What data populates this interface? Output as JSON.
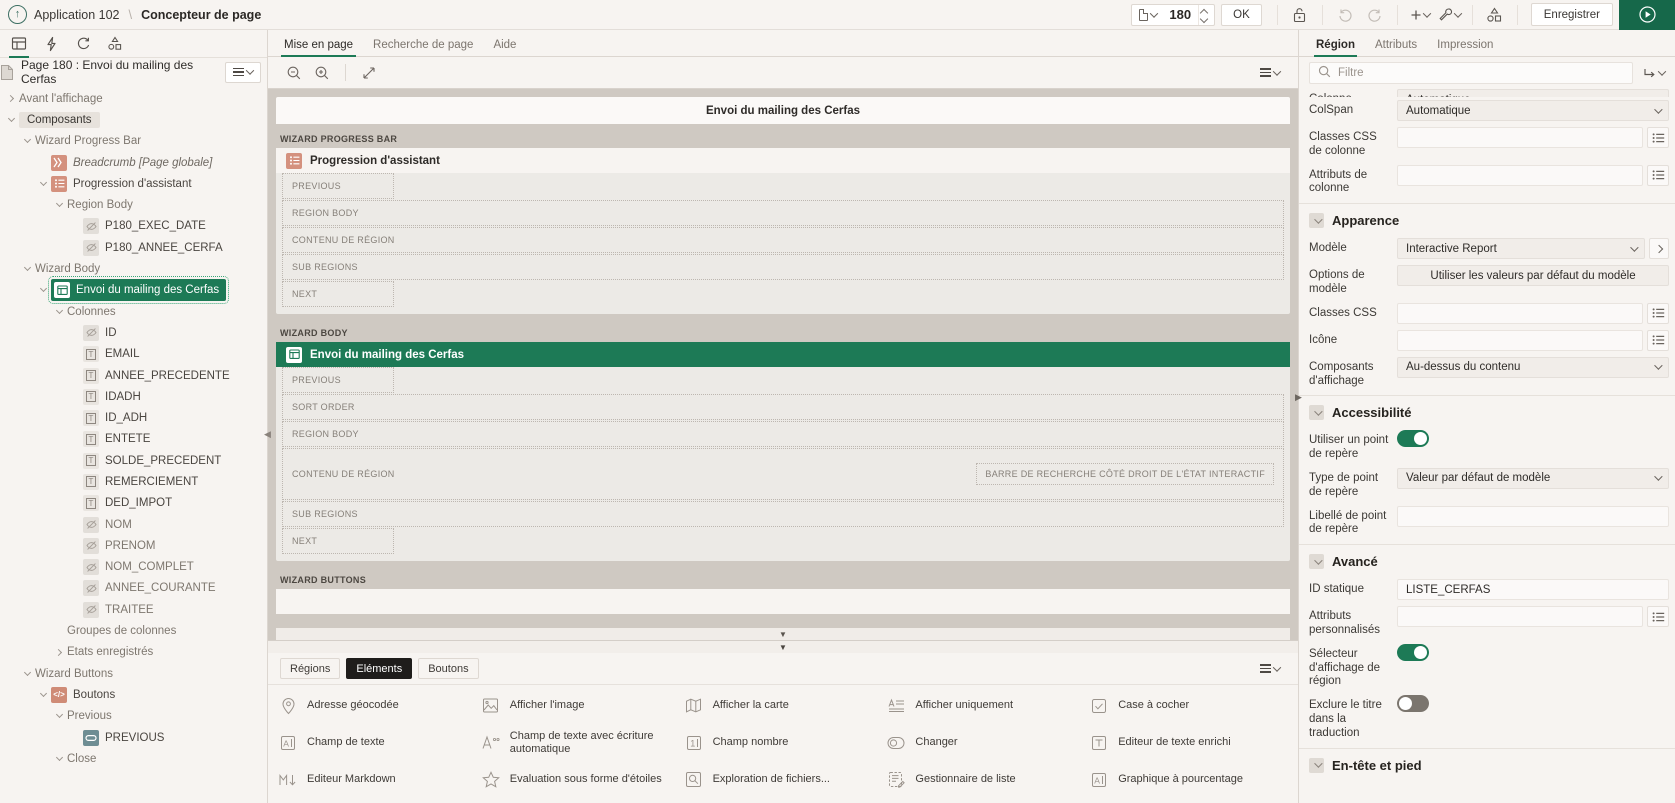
{
  "header": {
    "back_icon": "back-arrow-icon",
    "app_label": "Application 102",
    "separator": "\\",
    "page_designer_label": "Concepteur de page",
    "page_number": "180",
    "ok_label": "OK",
    "save_label": "Enregistrer",
    "icons": [
      "page-select-icon",
      "lock-icon",
      "undo-icon",
      "redo-icon",
      "add-icon",
      "utilities-icon",
      "shapes-icon",
      "run-icon"
    ]
  },
  "left_panel": {
    "tabs": [
      {
        "name": "page-layout-tab",
        "icon": "layout-icon",
        "selected": true
      },
      {
        "name": "dynamic-actions-tab",
        "icon": "lightning-icon",
        "selected": false
      },
      {
        "name": "processing-tab",
        "icon": "refresh-icon",
        "selected": false
      },
      {
        "name": "shared-components-tab",
        "icon": "shapes-icon",
        "selected": false
      }
    ],
    "page_title": "Page 180 : Envoi du mailing des Cerfas",
    "menu_label": "tree-menu-button",
    "tree": [
      {
        "label": "Avant l'affichage",
        "indent": 0,
        "twisty": "right",
        "icon": null,
        "style": "mut"
      },
      {
        "label": "Composants",
        "indent": 0,
        "twisty": "down",
        "icon": null,
        "style": "selhdr"
      },
      {
        "label": "Wizard Progress Bar",
        "indent": 1,
        "twisty": "down",
        "icon": null,
        "style": "mut"
      },
      {
        "label": "Breadcrumb [Page globale]",
        "indent": 2,
        "twisty": null,
        "icon": "bread",
        "style": "ital"
      },
      {
        "label": "Progression d'assistant",
        "indent": 2,
        "twisty": "down",
        "icon": "wiz",
        "style": ""
      },
      {
        "label": "Region Body",
        "indent": 3,
        "twisty": "down",
        "icon": null,
        "style": "mut"
      },
      {
        "label": "P180_EXEC_DATE",
        "indent": 4,
        "twisty": null,
        "icon": "hidden",
        "style": ""
      },
      {
        "label": "P180_ANNEE_CERFA",
        "indent": 4,
        "twisty": null,
        "icon": "hidden",
        "style": ""
      },
      {
        "label": "Wizard Body",
        "indent": 1,
        "twisty": "down",
        "icon": null,
        "style": "mut"
      },
      {
        "label": "Envoi du mailing des Cerfas",
        "indent": 2,
        "twisty": "down",
        "icon": "ir",
        "style": "selected"
      },
      {
        "label": "Colonnes",
        "indent": 3,
        "twisty": "down",
        "icon": null,
        "style": "mut"
      },
      {
        "label": "ID",
        "indent": 4,
        "twisty": null,
        "icon": "hidden",
        "style": ""
      },
      {
        "label": "EMAIL",
        "indent": 4,
        "twisty": null,
        "icon": "text",
        "style": ""
      },
      {
        "label": "ANNEE_PRECEDENTE",
        "indent": 4,
        "twisty": null,
        "icon": "text",
        "style": ""
      },
      {
        "label": "IDADH",
        "indent": 4,
        "twisty": null,
        "icon": "text",
        "style": ""
      },
      {
        "label": "ID_ADH",
        "indent": 4,
        "twisty": null,
        "icon": "text",
        "style": ""
      },
      {
        "label": "ENTETE",
        "indent": 4,
        "twisty": null,
        "icon": "text",
        "style": ""
      },
      {
        "label": "SOLDE_PRECEDENT",
        "indent": 4,
        "twisty": null,
        "icon": "text",
        "style": ""
      },
      {
        "label": "REMERCIEMENT",
        "indent": 4,
        "twisty": null,
        "icon": "text",
        "style": ""
      },
      {
        "label": "DED_IMPOT",
        "indent": 4,
        "twisty": null,
        "icon": "text",
        "style": ""
      },
      {
        "label": "NOM",
        "indent": 4,
        "twisty": null,
        "icon": "hidden",
        "style": "mut"
      },
      {
        "label": "PRENOM",
        "indent": 4,
        "twisty": null,
        "icon": "hidden",
        "style": "mut"
      },
      {
        "label": "NOM_COMPLET",
        "indent": 4,
        "twisty": null,
        "icon": "hidden",
        "style": "mut"
      },
      {
        "label": "ANNEE_COURANTE",
        "indent": 4,
        "twisty": null,
        "icon": "hidden",
        "style": "mut"
      },
      {
        "label": "TRAITEE",
        "indent": 4,
        "twisty": null,
        "icon": "hidden",
        "style": "mut"
      },
      {
        "label": "Groupes de colonnes",
        "indent": 3,
        "twisty": null,
        "icon": null,
        "style": "mut"
      },
      {
        "label": "Etats enregistrés",
        "indent": 3,
        "twisty": "right",
        "icon": null,
        "style": "mut"
      },
      {
        "label": "Wizard Buttons",
        "indent": 1,
        "twisty": "down",
        "icon": null,
        "style": "mut"
      },
      {
        "label": "Boutons",
        "indent": 2,
        "twisty": "down",
        "icon": "code",
        "style": ""
      },
      {
        "label": "Previous",
        "indent": 3,
        "twisty": "down",
        "icon": null,
        "style": "mut"
      },
      {
        "label": "PREVIOUS",
        "indent": 4,
        "twisty": null,
        "icon": "btn",
        "style": ""
      },
      {
        "label": "Close",
        "indent": 3,
        "twisty": "down",
        "icon": null,
        "style": "mut"
      }
    ]
  },
  "center_panel": {
    "tabs": [
      {
        "label": "Mise en page",
        "selected": true
      },
      {
        "label": "Recherche de page",
        "selected": false
      },
      {
        "label": "Aide",
        "selected": false
      }
    ],
    "tools": [
      "zoom-out-icon",
      "zoom-in-icon",
      "expand-icon"
    ],
    "tools_right": [
      "layout-options-icon"
    ],
    "page_header_title": "Envoi du mailing des Cerfas",
    "regions": [
      {
        "slot_label": "WIZARD PROGRESS BAR",
        "title": "Progression d'assistant",
        "title_style": "light",
        "icon": "wizard-progress-icon",
        "slots": [
          {
            "label": "PREVIOUS",
            "short": true
          },
          {
            "label": "REGION BODY",
            "short": false
          },
          {
            "label": "CONTENU DE RÉGION",
            "short": false
          },
          {
            "label": "SUB REGIONS",
            "short": false
          },
          {
            "label": "NEXT",
            "short": true
          }
        ],
        "right_slot": null
      },
      {
        "slot_label": "WIZARD BODY",
        "title": "Envoi du mailing des Cerfas",
        "title_style": "green",
        "icon": "interactive-report-icon",
        "slots": [
          {
            "label": "PREVIOUS",
            "short": true
          },
          {
            "label": "SORT ORDER",
            "short": false
          },
          {
            "label": "REGION BODY",
            "short": false
          },
          {
            "label": "CONTENU DE RÉGION",
            "short": false,
            "tall": true
          },
          {
            "label": "SUB REGIONS",
            "short": false
          },
          {
            "label": "NEXT",
            "short": true
          }
        ],
        "right_slot": "BARRE DE RECHERCHE CÔTÉ DROIT DE L'ÉTAT INTERACTIF"
      },
      {
        "slot_label": "WIZARD BUTTONS",
        "title": null,
        "title_style": "light",
        "icon": null,
        "slots": [],
        "right_slot": null
      }
    ]
  },
  "gallery": {
    "tabs": [
      {
        "label": "Régions",
        "selected": false
      },
      {
        "label": "Eléments",
        "selected": true
      },
      {
        "label": "Boutons",
        "selected": false
      }
    ],
    "menu_icon": "gallery-menu-icon",
    "items": [
      {
        "label": "Adresse géocodée",
        "icon": "map-pin-icon"
      },
      {
        "label": "Afficher l'image",
        "icon": "image-icon"
      },
      {
        "label": "Afficher la carte",
        "icon": "map-icon"
      },
      {
        "label": "Afficher uniquement",
        "icon": "display-only-icon"
      },
      {
        "label": "Case à cocher",
        "icon": "checkbox-icon"
      },
      {
        "label": "Champ de texte",
        "icon": "text-field-icon"
      },
      {
        "label": "Champ de texte avec écriture automatique",
        "icon": "autocomplete-icon"
      },
      {
        "label": "Champ nombre",
        "icon": "number-field-icon"
      },
      {
        "label": "Changer",
        "icon": "switch-icon"
      },
      {
        "label": "Editeur de texte enrichi",
        "icon": "rich-text-icon"
      },
      {
        "label": "Editeur Markdown",
        "icon": "markdown-icon"
      },
      {
        "label": "Evaluation sous forme d'étoiles",
        "icon": "star-rating-icon"
      },
      {
        "label": "Exploration de fichiers...",
        "icon": "file-browse-icon"
      },
      {
        "label": "Gestionnaire de liste",
        "icon": "list-manager-icon"
      },
      {
        "label": "Graphique à pourcentage",
        "icon": "percent-chart-icon"
      }
    ]
  },
  "right_panel": {
    "tabs": [
      {
        "label": "Région",
        "selected": true
      },
      {
        "label": "Attributs",
        "selected": false
      },
      {
        "label": "Impression",
        "selected": false
      }
    ],
    "filter_placeholder": "Filtre",
    "filter_value": "",
    "goto_icon": "go-to-group-icon",
    "clipped_row": {
      "label": "Colonne",
      "value": "Automatique"
    },
    "props_top": [
      {
        "label": "ColSpan",
        "type": "select",
        "value": "Automatique"
      },
      {
        "label": "Classes CSS de colonne",
        "type": "input-lov",
        "value": ""
      },
      {
        "label": "Attributs de colonne",
        "type": "input-lov",
        "value": ""
      }
    ],
    "sections": [
      {
        "title": "Apparence",
        "props": [
          {
            "label": "Modèle",
            "type": "select-arrow",
            "value": "Interactive Report"
          },
          {
            "label": "Options de modèle",
            "type": "button-center",
            "value": "Utiliser les valeurs par défaut du modèle"
          },
          {
            "label": "Classes CSS",
            "type": "input-lov",
            "value": ""
          },
          {
            "label": "Icône",
            "type": "input-lov",
            "value": ""
          },
          {
            "label": "Composants d'affichage",
            "type": "select",
            "value": "Au-dessus du contenu"
          }
        ]
      },
      {
        "title": "Accessibilité",
        "props": [
          {
            "label": "Utiliser un point de repère",
            "type": "switch",
            "value": "on"
          },
          {
            "label": "Type de point de repère",
            "type": "select",
            "value": "Valeur par défaut de modèle"
          },
          {
            "label": "Libellé de point de repère",
            "type": "input",
            "value": ""
          }
        ]
      },
      {
        "title": "Avancé",
        "props": [
          {
            "label": "ID statique",
            "type": "input",
            "value": "LISTE_CERFAS"
          },
          {
            "label": "Attributs personnalisés",
            "type": "input-lov",
            "value": ""
          },
          {
            "label": "Sélecteur d'affichage de région",
            "type": "switch",
            "value": "on"
          },
          {
            "label": "Exclure le titre dans la traduction",
            "type": "switch",
            "value": "off"
          }
        ]
      },
      {
        "title": "En-tête et pied",
        "props": []
      }
    ]
  },
  "colors": {
    "accent_green": "#1d7a56",
    "bg": "#f7f4f1",
    "canvas": "#cfc9c2",
    "orange_icon": "#d4917e"
  }
}
